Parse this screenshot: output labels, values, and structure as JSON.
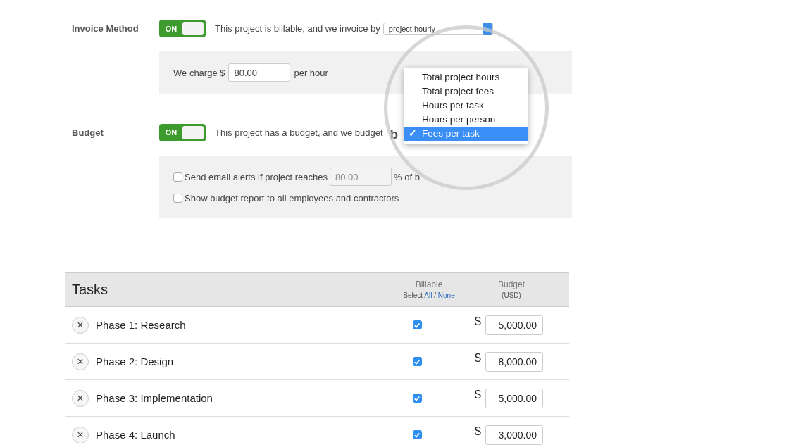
{
  "invoice": {
    "label": "Invoice Method",
    "toggle": {
      "label": "ON",
      "on": true
    },
    "text": "This project is billable, and we invoice by",
    "select_value": "project hourly",
    "charge_prefix": "We charge $",
    "rate": "80.00",
    "charge_suffix": "per hour"
  },
  "budget": {
    "label": "Budget",
    "toggle": {
      "label": "ON",
      "on": true
    },
    "text": "This project has a budget, and we budget",
    "magnified_text": "b",
    "options": [
      {
        "label": "Send email alerts if project reaches",
        "checked": false,
        "value": "80.00",
        "suffix": "% of b"
      },
      {
        "label": "Show budget report to all employees and contractors",
        "checked": false
      }
    ]
  },
  "dropdown": {
    "check": "✓",
    "items": [
      {
        "label": "Total project hours",
        "selected": false
      },
      {
        "label": "Total project fees",
        "selected": false
      },
      {
        "label": "Hours per task",
        "selected": false
      },
      {
        "label": "Hours per person",
        "selected": false
      },
      {
        "label": "Fees per task",
        "selected": true
      }
    ]
  },
  "tasks": {
    "title": "Tasks",
    "billable_header": "Billable",
    "select_prefix": "Select",
    "select_all": "All",
    "select_sep": "/",
    "select_none": "None",
    "budget_header": "Budget",
    "budget_unit": "(USD)",
    "currency": "$",
    "remove": "×",
    "rows": [
      {
        "name": "Phase 1: Research",
        "billable": true,
        "budget": "5,000.00"
      },
      {
        "name": "Phase 2: Design",
        "billable": true,
        "budget": "8,000.00"
      },
      {
        "name": "Phase 3: Implementation",
        "billable": true,
        "budget": "5,000.00"
      },
      {
        "name": "Phase 4: Launch",
        "billable": true,
        "budget": "3,000.00"
      }
    ]
  }
}
